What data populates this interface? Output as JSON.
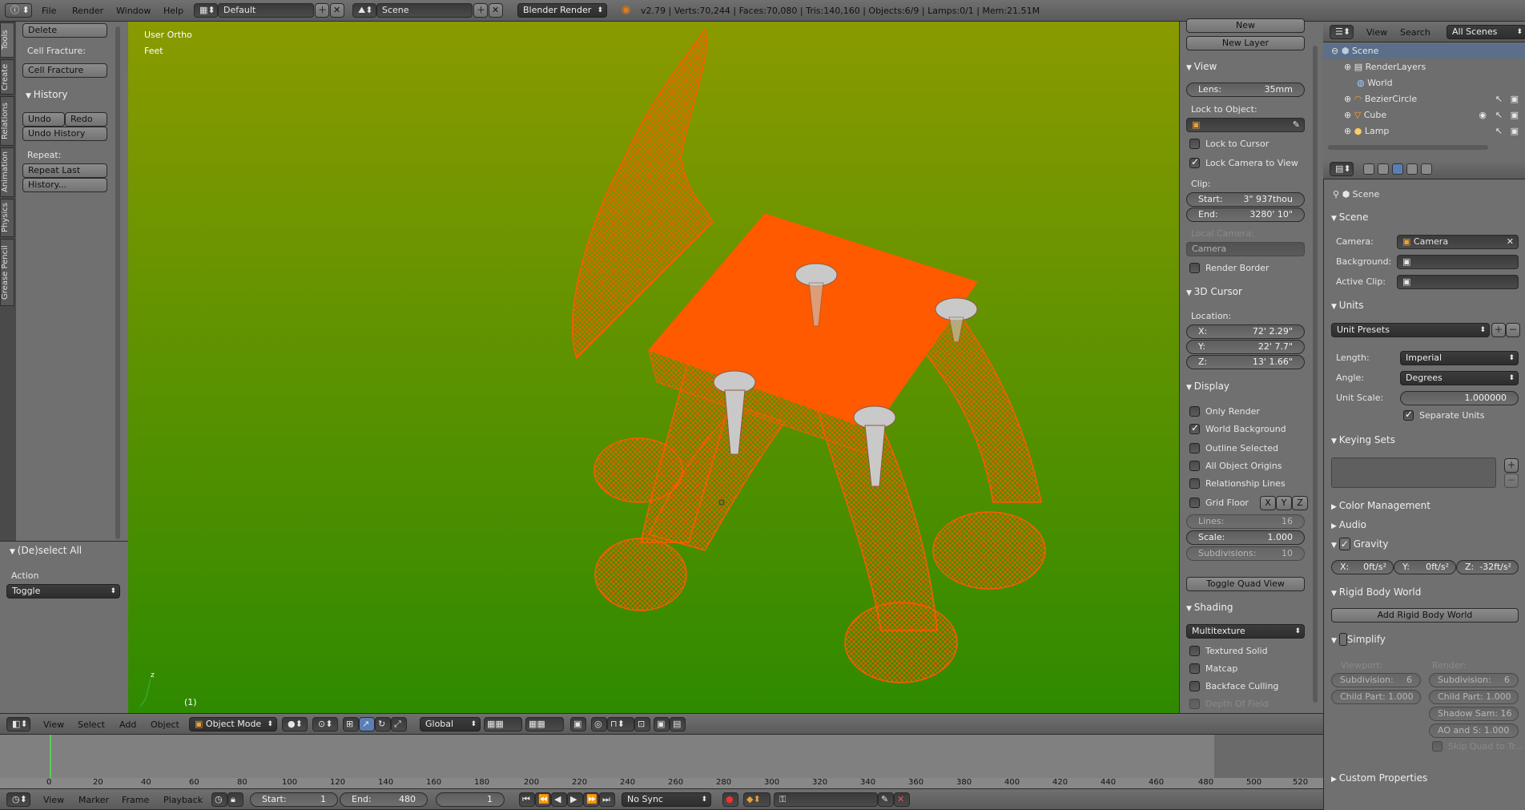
{
  "top_bar": {
    "menus": [
      "File",
      "Render",
      "Window",
      "Help"
    ],
    "layout": "Default",
    "scene": "Scene",
    "engine": "Blender Render",
    "stats": "v2.79 | Verts:70,244 | Faces:70,080 | Tris:140,160 | Objects:6/9 | Lamps:0/1 | Mem:21.51M"
  },
  "left_tabs": [
    "Tools",
    "Create",
    "Relations",
    "Animation",
    "Physics",
    "Grease Pencil"
  ],
  "tool_shelf": {
    "delete": "Delete",
    "cell_fracture_label": "Cell Fracture:",
    "cell_fracture_btn": "Cell Fracture",
    "history_title": "History",
    "undo": "Undo",
    "redo": "Redo",
    "undo_history": "Undo History",
    "repeat_label": "Repeat:",
    "repeat_last": "Repeat Last",
    "history_btn": "History..."
  },
  "operator_panel": {
    "title": "(De)select All",
    "action_label": "Action",
    "action_value": "Toggle"
  },
  "viewport": {
    "view_name": "User Ortho",
    "units": "Feet",
    "frame": "(1)",
    "colors": {
      "top": "#8a9a00",
      "bottom": "#2f8a00",
      "mesh": "#ff5a00"
    }
  },
  "view_header": {
    "menus": [
      "View",
      "Select",
      "Add",
      "Object"
    ],
    "mode": "Object Mode",
    "orientation": "Global"
  },
  "properties_n": {
    "new_btn": "New",
    "new_layer": "New Layer",
    "view_title": "View",
    "lens_label": "Lens:",
    "lens_value": "35mm",
    "lock_to_object": "Lock to Object:",
    "lock_to_cursor": "Lock to Cursor",
    "lock_camera": "Lock Camera to View",
    "clip": "Clip:",
    "start_label": "Start:",
    "start_value": "3\" 937thou",
    "end_label": "End:",
    "end_value": "3280' 10\"",
    "local_camera": "Local Camera:",
    "camera_value": "Camera",
    "render_border": "Render Border",
    "cursor_title": "3D Cursor",
    "location": "Location:",
    "x_label": "X:",
    "x_value": "72' 2.29\"",
    "y_label": "Y:",
    "y_value": "22' 7.7\"",
    "z_label": "Z:",
    "z_value": "13' 1.66\"",
    "display_title": "Display",
    "only_render": "Only Render",
    "world_background": "World Background",
    "outline_selected": "Outline Selected",
    "all_origins": "All Object Origins",
    "relationship_lines": "Relationship Lines",
    "grid_floor": "Grid Floor",
    "axis_x": "X",
    "axis_y": "Y",
    "axis_z": "Z",
    "lines_label": "Lines:",
    "lines_value": "16",
    "scale_label": "Scale:",
    "scale_value": "1.000",
    "subdiv_label": "Subdivisions:",
    "subdiv_value": "10",
    "toggle_quad": "Toggle Quad View",
    "shading_title": "Shading",
    "shading_mode": "Multitexture",
    "textured_solid": "Textured Solid",
    "matcap": "Matcap",
    "backface": "Backface Culling",
    "dof": "Depth Of Field"
  },
  "outliner": {
    "menus": [
      "View",
      "Search"
    ],
    "filter": "All Scenes",
    "items": [
      "Scene",
      "RenderLayers",
      "World",
      "BezierCircle",
      "Cube",
      "Lamp"
    ]
  },
  "scene_props": {
    "breadcrumb": "Scene",
    "scene_title": "Scene",
    "camera_label": "Camera:",
    "camera_value": "Camera",
    "background_label": "Background:",
    "active_clip_label": "Active Clip:",
    "units_title": "Units",
    "unit_presets": "Unit Presets",
    "length_label": "Length:",
    "length_value": "Imperial",
    "angle_label": "Angle:",
    "angle_value": "Degrees",
    "unit_scale_label": "Unit Scale:",
    "unit_scale_value": "1.000000",
    "separate_units": "Separate Units",
    "keying_sets": "Keying Sets",
    "color_management": "Color Management",
    "audio": "Audio",
    "gravity": "Gravity",
    "gx": "X:",
    "gx_v": "0ft/s²",
    "gy": "Y:",
    "gy_v": "0ft/s²",
    "gz": "Z:",
    "gz_v": "-32ft/s²",
    "rigid_body": "Rigid Body World",
    "add_rigid": "Add Rigid Body World",
    "simplify": "Simplify",
    "viewport": "Viewport:",
    "render": "Render:",
    "subdiv_vp": "Subdivision:",
    "subdiv_vp_v": "6",
    "subdiv_r": "Subdivision:",
    "subdiv_r_v": "6",
    "child_vp": "Child Part: 1.000",
    "child_r": "Child Part: 1.000",
    "shadow": "Shadow Sam: 16",
    "ao": "AO and S: 1.000",
    "skip_quad": "Skip Quad to Tr...",
    "custom_props": "Custom Properties"
  },
  "timeline": {
    "ticks": [
      "0",
      "20",
      "40",
      "60",
      "80",
      "100",
      "120",
      "140",
      "160",
      "180",
      "200",
      "220",
      "240",
      "260",
      "280",
      "300",
      "320",
      "340",
      "360",
      "380",
      "400",
      "420",
      "440",
      "460",
      "480",
      "500",
      "520"
    ],
    "menus": [
      "View",
      "Marker",
      "Frame",
      "Playback"
    ],
    "start_label": "Start:",
    "start_value": "1",
    "end_label": "End:",
    "end_value": "480",
    "current": "1",
    "sync": "No Sync"
  }
}
